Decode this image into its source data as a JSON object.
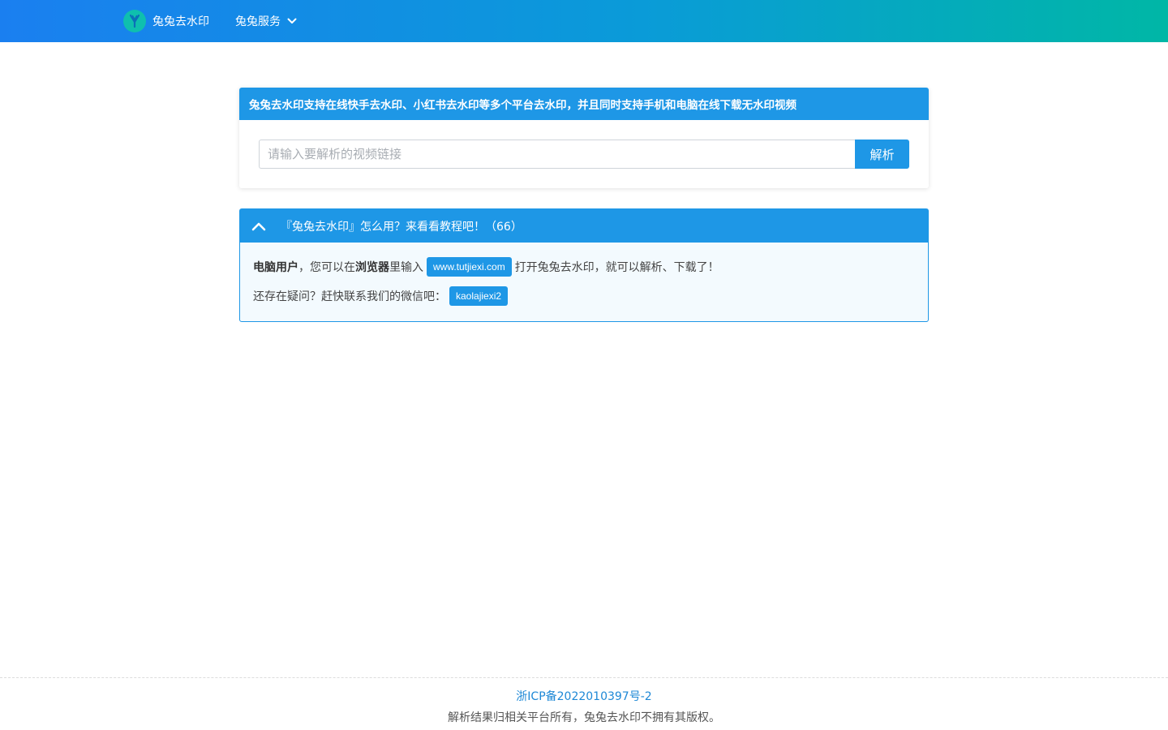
{
  "navbar": {
    "brand_label": "兔兔去水印",
    "logo_icon": "rabbit-logo-icon",
    "menu_label": "兔兔服务",
    "menu_icon": "chevron-down-icon",
    "gradient_colors": [
      "#1a7ff0",
      "#0a9bd8",
      "#00b7a6"
    ]
  },
  "parse_panel": {
    "title": "兔兔去水印支持在线快手去水印、小红书去水印等多个平台去水印，并且同时支持手机和电脑在线下载无水印视频",
    "input_placeholder": "请输入要解析的视频链接",
    "input_value": "",
    "button_label": "解析"
  },
  "tutorial_panel": {
    "toggle_icon": "chevron-up-icon",
    "title": "『兔兔去水印』怎么用？来看看教程吧！（66）",
    "line1": {
      "strong1": "电脑用户",
      "text1": "，您可以在",
      "strong2": "浏览器",
      "text2": "里输入",
      "tag": "www.tutjiexi.com",
      "text3": "打开兔兔去水印，就可以解析、下载了！"
    },
    "line2": {
      "text": "还存在疑问？赶快联系我们的微信吧：",
      "tag": "kaolajiexi2"
    }
  },
  "footer": {
    "icp": "浙ICP备2022010397号-2",
    "copyright": "解析结果归相关平台所有，兔兔去水印不拥有其版权。"
  },
  "colors": {
    "accent": "#1e97e6",
    "link": "#1e88d6"
  }
}
